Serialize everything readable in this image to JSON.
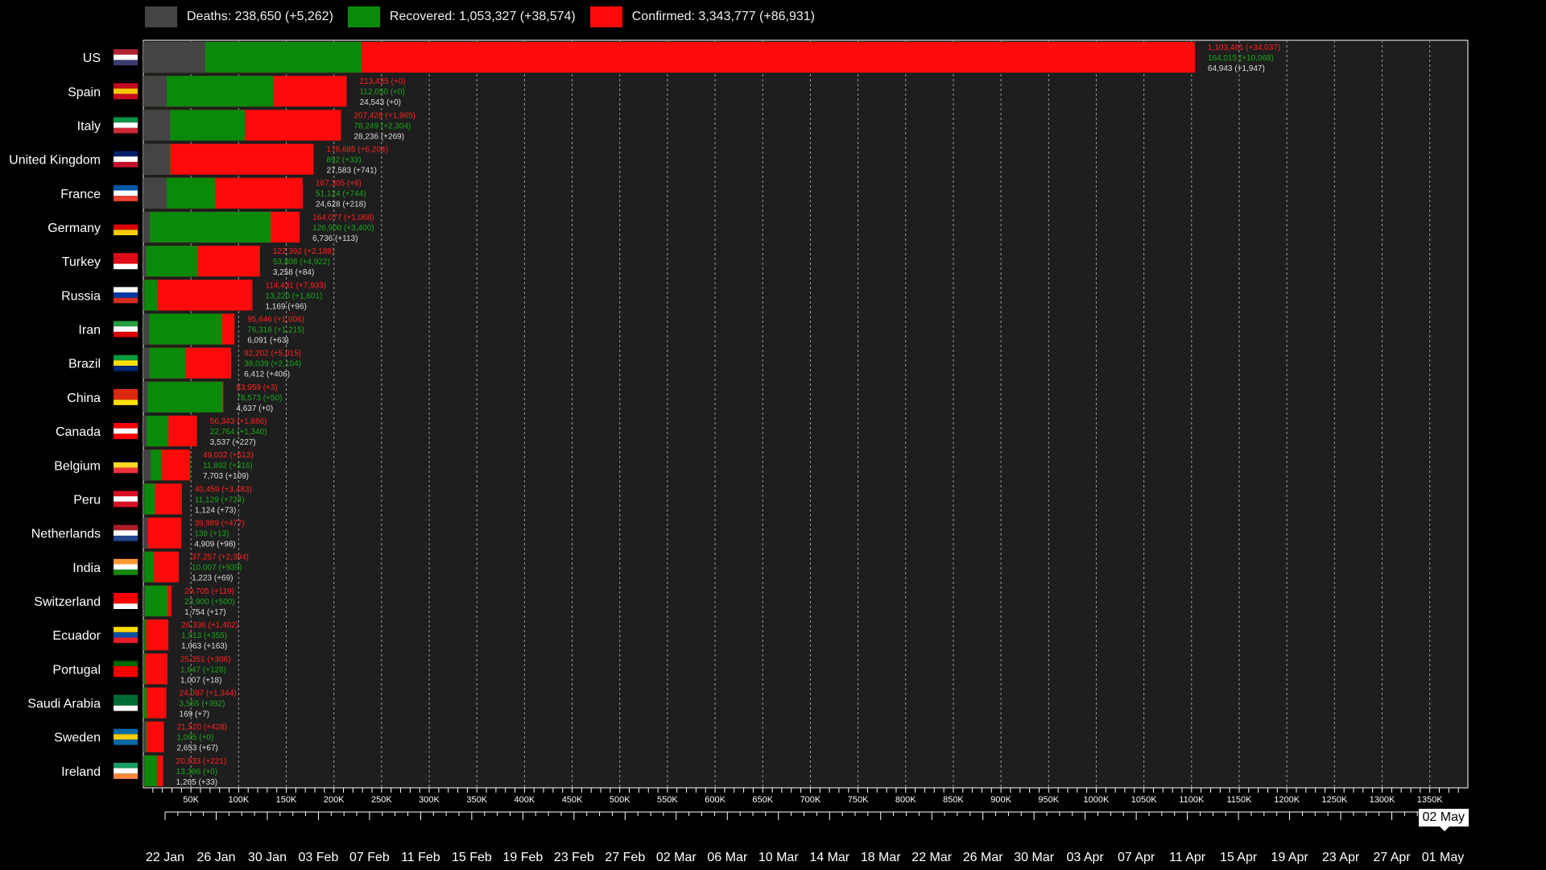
{
  "legend": {
    "deaths": "Deaths: 238,650 (+5,262)",
    "recovered": "Recovered: 1,053,327 (+38,574)",
    "confirmed": "Confirmed: 3,343,777 (+86,931)"
  },
  "colors": {
    "deaths": "#444444",
    "recovered": "#0a8a0a",
    "confirmed": "#ff0a0a",
    "background": "#1e1e1e"
  },
  "current_date": "02 May",
  "timeline_labels": [
    "22 Jan",
    "26 Jan",
    "30 Jan",
    "03 Feb",
    "07 Feb",
    "11 Feb",
    "15 Feb",
    "19 Feb",
    "23 Feb",
    "27 Feb",
    "02 Mar",
    "06 Mar",
    "10 Mar",
    "14 Mar",
    "18 Mar",
    "22 Mar",
    "26 Mar",
    "30 Mar",
    "03 Apr",
    "07 Apr",
    "11 Apr",
    "15 Apr",
    "19 Apr",
    "23 Apr",
    "27 Apr",
    "01 May"
  ],
  "chart_data": {
    "type": "bar",
    "orientation": "horizontal",
    "stacked": true,
    "xlim": [
      0,
      1390000
    ],
    "x_ticks": [
      "50K",
      "100K",
      "150K",
      "200K",
      "250K",
      "300K",
      "350K",
      "400K",
      "450K",
      "500K",
      "550K",
      "600K",
      "650K",
      "700K",
      "750K",
      "800K",
      "850K",
      "900K",
      "950K",
      "1000K",
      "1050K",
      "1100K",
      "1150K",
      "1200K",
      "1250K",
      "1300K",
      "1350K"
    ],
    "x_tick_values": [
      50000,
      100000,
      150000,
      200000,
      250000,
      300000,
      350000,
      400000,
      450000,
      500000,
      550000,
      600000,
      650000,
      700000,
      750000,
      800000,
      850000,
      900000,
      950000,
      1000000,
      1050000,
      1100000,
      1150000,
      1200000,
      1250000,
      1300000,
      1350000
    ],
    "grid": true,
    "legend_position": "top",
    "flag_colors": {
      "US": [
        "#b22234",
        "#ffffff",
        "#3c3b6e"
      ],
      "Spain": [
        "#c60b1e",
        "#ffc400",
        "#c60b1e"
      ],
      "Italy": [
        "#009246",
        "#ffffff",
        "#ce2b37"
      ],
      "United Kingdom": [
        "#012169",
        "#ffffff",
        "#c8102e"
      ],
      "France": [
        "#0055a4",
        "#ffffff",
        "#ef4135"
      ],
      "Germany": [
        "#000000",
        "#dd0000",
        "#ffce00"
      ],
      "Turkey": [
        "#e30a17",
        "#e30a17",
        "#ffffff"
      ],
      "Russia": [
        "#ffffff",
        "#0039a6",
        "#d52b1e"
      ],
      "Iran": [
        "#239f40",
        "#ffffff",
        "#da0000"
      ],
      "Brazil": [
        "#009c3b",
        "#ffdf00",
        "#002776"
      ],
      "China": [
        "#de2910",
        "#de2910",
        "#ffde00"
      ],
      "Canada": [
        "#ff0000",
        "#ffffff",
        "#ff0000"
      ],
      "Belgium": [
        "#000000",
        "#fdda24",
        "#ef3340"
      ],
      "Peru": [
        "#d91023",
        "#ffffff",
        "#d91023"
      ],
      "Netherlands": [
        "#ae1c28",
        "#ffffff",
        "#21468b"
      ],
      "India": [
        "#ff9933",
        "#ffffff",
        "#138808"
      ],
      "Switzerland": [
        "#ff0000",
        "#ff0000",
        "#ffffff"
      ],
      "Ecuador": [
        "#ffdd00",
        "#034ea2",
        "#ed1c24"
      ],
      "Portugal": [
        "#006600",
        "#ff0000",
        "#ff0000"
      ],
      "Saudi Arabia": [
        "#006c35",
        "#006c35",
        "#ffffff"
      ],
      "Sweden": [
        "#006aa7",
        "#fecc00",
        "#006aa7"
      ],
      "Ireland": [
        "#169b62",
        "#ffffff",
        "#ff883e"
      ]
    },
    "series_names": [
      "Deaths",
      "Recovered",
      "Confirmed"
    ],
    "countries": [
      {
        "name": "US",
        "confirmed": 1103461,
        "confirmed_label": "1,103,461 (+34,037)",
        "recovered": 164015,
        "recovered_label": "164,015 (+10,068)",
        "deaths": 64943,
        "deaths_label": "64,943 (+1,947)"
      },
      {
        "name": "Spain",
        "confirmed": 213435,
        "confirmed_label": "213,435 (+0)",
        "recovered": 112050,
        "recovered_label": "112,050 (+0)",
        "deaths": 24543,
        "deaths_label": "24,543 (+0)"
      },
      {
        "name": "Italy",
        "confirmed": 207428,
        "confirmed_label": "207,428 (+1,965)",
        "recovered": 78249,
        "recovered_label": "78,249 (+2,304)",
        "deaths": 28236,
        "deaths_label": "28,236 (+269)"
      },
      {
        "name": "United Kingdom",
        "confirmed": 178685,
        "confirmed_label": "178,685 (+6,204)",
        "recovered": 892,
        "recovered_label": "892 (+33)",
        "deaths": 27583,
        "deaths_label": "27,583 (+741)"
      },
      {
        "name": "France",
        "confirmed": 167305,
        "confirmed_label": "167,305 (+6)",
        "recovered": 51124,
        "recovered_label": "51,124 (+744)",
        "deaths": 24628,
        "deaths_label": "24,628 (+218)"
      },
      {
        "name": "Germany",
        "confirmed": 164077,
        "confirmed_label": "164,077 (+1,068)",
        "recovered": 126900,
        "recovered_label": "126,900 (+3,400)",
        "deaths": 6736,
        "deaths_label": "6,736 (+113)"
      },
      {
        "name": "Turkey",
        "confirmed": 122392,
        "confirmed_label": "122,392 (+2,188)",
        "recovered": 53808,
        "recovered_label": "53,808 (+4,922)",
        "deaths": 3258,
        "deaths_label": "3,258 (+84)"
      },
      {
        "name": "Russia",
        "confirmed": 114431,
        "confirmed_label": "114,431 (+7,933)",
        "recovered": 13220,
        "recovered_label": "13,220 (+1,601)",
        "deaths": 1169,
        "deaths_label": "1,169 (+96)"
      },
      {
        "name": "Iran",
        "confirmed": 95646,
        "confirmed_label": "95,646 (+1,006)",
        "recovered": 76318,
        "recovered_label": "76,318 (+1,215)",
        "deaths": 6091,
        "deaths_label": "6,091 (+63)"
      },
      {
        "name": "Brazil",
        "confirmed": 92202,
        "confirmed_label": "92,202 (+5,015)",
        "recovered": 38039,
        "recovered_label": "38,039 (+2,104)",
        "deaths": 6412,
        "deaths_label": "6,412 (+406)"
      },
      {
        "name": "China",
        "confirmed": 83959,
        "confirmed_label": "83,959 (+3)",
        "recovered": 78573,
        "recovered_label": "78,573 (+50)",
        "deaths": 4637,
        "deaths_label": "4,637 (+0)"
      },
      {
        "name": "Canada",
        "confirmed": 56343,
        "confirmed_label": "56,343 (+1,886)",
        "recovered": 22764,
        "recovered_label": "22,764 (+1,340)",
        "deaths": 3537,
        "deaths_label": "3,537 (+227)"
      },
      {
        "name": "Belgium",
        "confirmed": 49032,
        "confirmed_label": "49,032 (+513)",
        "recovered": 11892,
        "recovered_label": "11,892 (+316)",
        "deaths": 7703,
        "deaths_label": "7,703 (+109)"
      },
      {
        "name": "Peru",
        "confirmed": 40459,
        "confirmed_label": "40,459 (+3,483)",
        "recovered": 11129,
        "recovered_label": "11,129 (+724)",
        "deaths": 1124,
        "deaths_label": "1,124 (+73)"
      },
      {
        "name": "Netherlands",
        "confirmed": 39989,
        "confirmed_label": "39,989 (+477)",
        "recovered": 138,
        "recovered_label": "138 (+13)",
        "deaths": 4909,
        "deaths_label": "4,909 (+98)"
      },
      {
        "name": "India",
        "confirmed": 37257,
        "confirmed_label": "37,257 (+2,394)",
        "recovered": 10007,
        "recovered_label": "10,007 (+939)",
        "deaths": 1223,
        "deaths_label": "1,223 (+69)"
      },
      {
        "name": "Switzerland",
        "confirmed": 29705,
        "confirmed_label": "29,705 (+119)",
        "recovered": 23900,
        "recovered_label": "23,900 (+500)",
        "deaths": 1754,
        "deaths_label": "1,754 (+17)"
      },
      {
        "name": "Ecuador",
        "confirmed": 26336,
        "confirmed_label": "26,336 (+1,402)",
        "recovered": 1913,
        "recovered_label": "1,913 (+355)",
        "deaths": 1063,
        "deaths_label": "1,063 (+163)"
      },
      {
        "name": "Portugal",
        "confirmed": 25351,
        "confirmed_label": "25,351 (+306)",
        "recovered": 1647,
        "recovered_label": "1,647 (+128)",
        "deaths": 1007,
        "deaths_label": "1,007 (+18)"
      },
      {
        "name": "Saudi Arabia",
        "confirmed": 24097,
        "confirmed_label": "24,097 (+1,344)",
        "recovered": 3555,
        "recovered_label": "3,555 (+392)",
        "deaths": 169,
        "deaths_label": "169 (+7)"
      },
      {
        "name": "Sweden",
        "confirmed": 21520,
        "confirmed_label": "21,520 (+428)",
        "recovered": 1005,
        "recovered_label": "1,005 (+0)",
        "deaths": 2653,
        "deaths_label": "2,653 (+67)"
      },
      {
        "name": "Ireland",
        "confirmed": 20833,
        "confirmed_label": "20,833 (+221)",
        "recovered": 13386,
        "recovered_label": "13,386 (+0)",
        "deaths": 1265,
        "deaths_label": "1,265 (+33)"
      }
    ]
  }
}
